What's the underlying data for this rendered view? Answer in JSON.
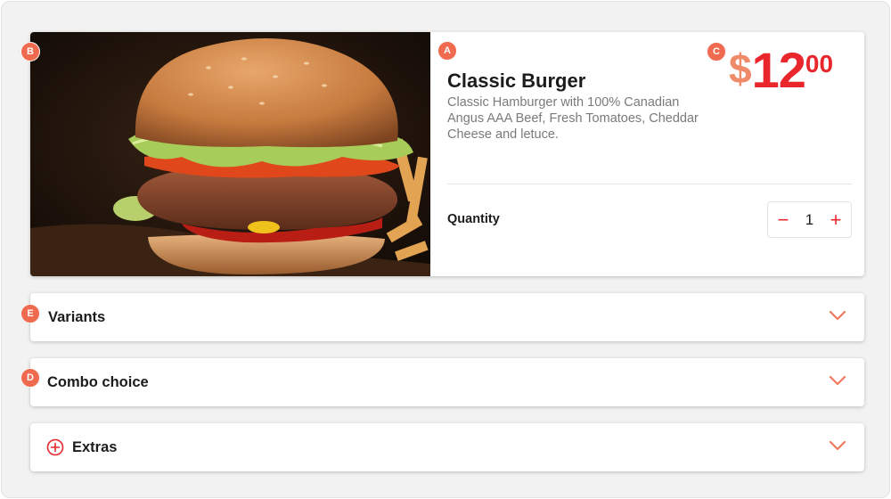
{
  "product": {
    "title": "Classic Burger",
    "description": "Classic Hamburger with 100% Canadian Angus AAA Beef, Fresh Tomatoes, Cheddar Cheese and letuce.",
    "price": {
      "currency": "$",
      "whole": "12",
      "cents": "00"
    },
    "quantity_label": "Quantity",
    "quantity": "1",
    "decrement_symbol": "−",
    "increment_symbol": "+",
    "image_icon": "burger-photo"
  },
  "accordions": {
    "variants": {
      "label": "Variants",
      "icon": "chevron-down-icon"
    },
    "combo": {
      "label": "Combo choice",
      "icon": "chevron-down-icon"
    },
    "extras": {
      "label": "Extras",
      "icon": "plus-circle-icon"
    }
  },
  "markers": {
    "a": "A",
    "b": "B",
    "c": "C",
    "d": "D",
    "e": "E"
  },
  "colors": {
    "accent": "#e8262c",
    "currency": "#ef8a6a",
    "marker": "#f06a4f",
    "chevron": "#f07a5c",
    "background": "#f2f2f2"
  }
}
